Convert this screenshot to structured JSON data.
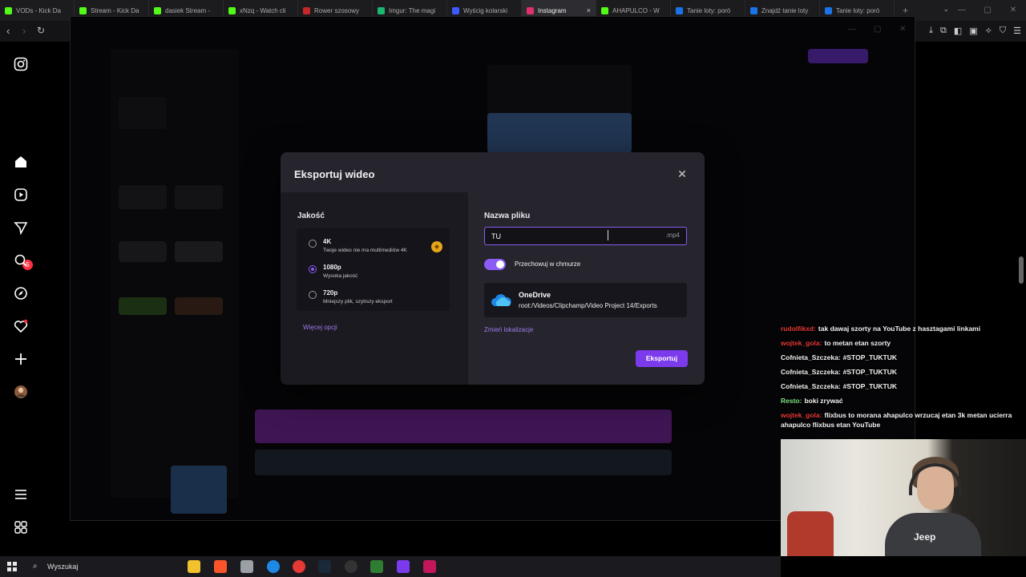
{
  "browser": {
    "tabs": [
      {
        "label": "VODs - Kick Da",
        "color": "#53fc18"
      },
      {
        "label": "Stream - Kick Da",
        "color": "#53fc18"
      },
      {
        "label": "dasiek Stream -",
        "color": "#53fc18"
      },
      {
        "label": "xNzq - Watch cli",
        "color": "#53fc18"
      },
      {
        "label": "Rower szosowy",
        "color": "#c62828"
      },
      {
        "label": "Imgur: The magi",
        "color": "#1bb76e"
      },
      {
        "label": "Wyścig kolarski",
        "color": "#3d5afe"
      },
      {
        "label": "Instagram",
        "color": "#e1306c"
      },
      {
        "label": "AHAPULCO - W",
        "color": "#53fc18"
      },
      {
        "label": "Tanie loty: poró",
        "color": "#1a73e8"
      },
      {
        "label": "Znajdź tanie loty",
        "color": "#1a73e8"
      },
      {
        "label": "Tanie loty: poró",
        "color": "#1a73e8"
      }
    ],
    "active_tab_index": 7,
    "tab_close": "×",
    "new_tab": "+"
  },
  "modal": {
    "title": "Eksportuj wideo",
    "close": "✕",
    "quality_label": "Jakość",
    "options": [
      {
        "name": "4K",
        "desc": "Twoje wideo nie ma multimediów 4K",
        "checked": false
      },
      {
        "name": "1080p",
        "desc": "Wysoka jakość",
        "checked": true
      },
      {
        "name": "720p",
        "desc": "Mniejszy plik, szybszy eksport",
        "checked": false
      }
    ],
    "more_options": "Więcej opcji",
    "filename_label": "Nazwa pliku",
    "filename_value": "TU",
    "filename_ext": ".mp4",
    "cloud_toggle_label": "Przechowuj w chmurze",
    "cloud_toggle_on": true,
    "destination_name": "OneDrive",
    "destination_path": "root:/Videos/Clipchamp/Video Project 14/Exports",
    "change_location": "Zmień lokalizacje",
    "export_button": "Eksportuj",
    "accent": "#7c3aed"
  },
  "instagram_sidebar": {
    "notification_count": "5"
  },
  "chat": [
    {
      "user": "rudolfikxd:",
      "color": "#e53935",
      "text": "tak dawaj szorty na YouTube z hasztagami linkami"
    },
    {
      "user": "wojtek_gola:",
      "color": "#e53935",
      "text": "to metan etan szorty"
    },
    {
      "user": "Cofnieta_Szczeka:",
      "color": "#f2f2f2",
      "text": "#STOP_TUKTUK"
    },
    {
      "user": "Cofnieta_Szczeka:",
      "color": "#f2f2f2",
      "text": "#STOP_TUKTUK"
    },
    {
      "user": "Cofnieta_Szczeka:",
      "color": "#f2f2f2",
      "text": "#STOP_TUKTUK"
    },
    {
      "user": "Resto:",
      "color": "#7ee081",
      "text": "boki zrywać"
    },
    {
      "user": "wojtek_gola:",
      "color": "#e53935",
      "text": "flixbus to morana ahapulco wrzucaj etan 3k metan ucierra ahapulco flixbus etan YouTube"
    }
  ],
  "webcam": {
    "shirt_text": "Jeep"
  },
  "taskbar": {
    "search_placeholder": "Wyszukaj"
  }
}
